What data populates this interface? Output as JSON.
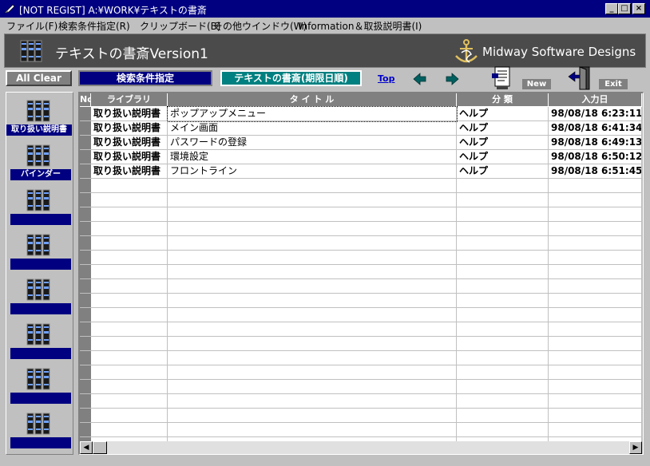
{
  "window": {
    "title": "[NOT REGIST]  A:¥WORK¥テキストの書斎",
    "minimize": "_",
    "maximize": "□",
    "close": "×"
  },
  "menu": [
    "ファイル(F)",
    "検索条件指定(R)",
    "クリップボード(B)",
    "その他ウインドウ(W)",
    "Information＆取扱説明書(I)"
  ],
  "header": {
    "app_title": "テキストの書斎Version1",
    "brand": "Midway Software Designs"
  },
  "toolbar": {
    "all_clear": "All Clear",
    "search_conditions": "検索条件指定",
    "sort_view": "テキストの書斎(期限日順)",
    "top_link": "Top",
    "new_label": "New",
    "exit_label": "Exit"
  },
  "sidebar": {
    "items": [
      {
        "label": "取り扱い説明書"
      },
      {
        "label": "バインダー"
      },
      {
        "label": ""
      },
      {
        "label": ""
      },
      {
        "label": ""
      },
      {
        "label": ""
      },
      {
        "label": ""
      },
      {
        "label": ""
      }
    ]
  },
  "table": {
    "columns": [
      "No",
      "ライブラリ",
      "タ イ ト ル",
      "分 類",
      "入力日"
    ],
    "rows": [
      {
        "library": "取り扱い説明書",
        "title": "ポップアップメニュー",
        "category": "ヘルプ",
        "date": "98/08/18  6:23:11"
      },
      {
        "library": "取り扱い説明書",
        "title": "メイン画面",
        "category": "ヘルプ",
        "date": "98/08/18  6:41:34"
      },
      {
        "library": "取り扱い説明書",
        "title": "パスワードの登録",
        "category": "ヘルプ",
        "date": "98/08/18  6:49:13"
      },
      {
        "library": "取り扱い説明書",
        "title": "環境設定",
        "category": "ヘルプ",
        "date": "98/08/18  6:50:12"
      },
      {
        "library": "取り扱い説明書",
        "title": "フロントライン",
        "category": "ヘルプ",
        "date": "98/08/18  6:51:45"
      }
    ]
  },
  "colors": {
    "titlebar": "#000080",
    "header_bg": "#4b4b4b",
    "search_button": "#000080",
    "sort_button": "#008080"
  }
}
